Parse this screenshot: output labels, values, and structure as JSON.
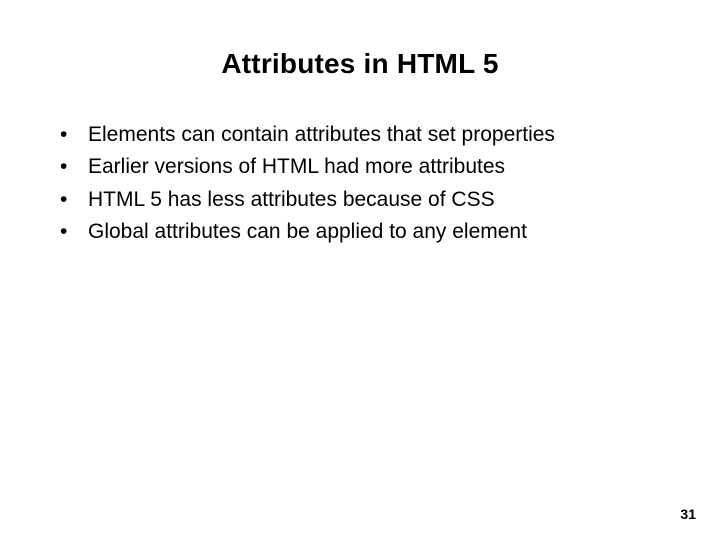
{
  "slide": {
    "title": "Attributes in HTML 5",
    "bullets": [
      "Elements can contain attributes that set properties",
      "Earlier versions of HTML had more attributes",
      "HTML 5 has less attributes because of CSS",
      "Global attributes can be applied to any element"
    ],
    "page_number": "31"
  }
}
